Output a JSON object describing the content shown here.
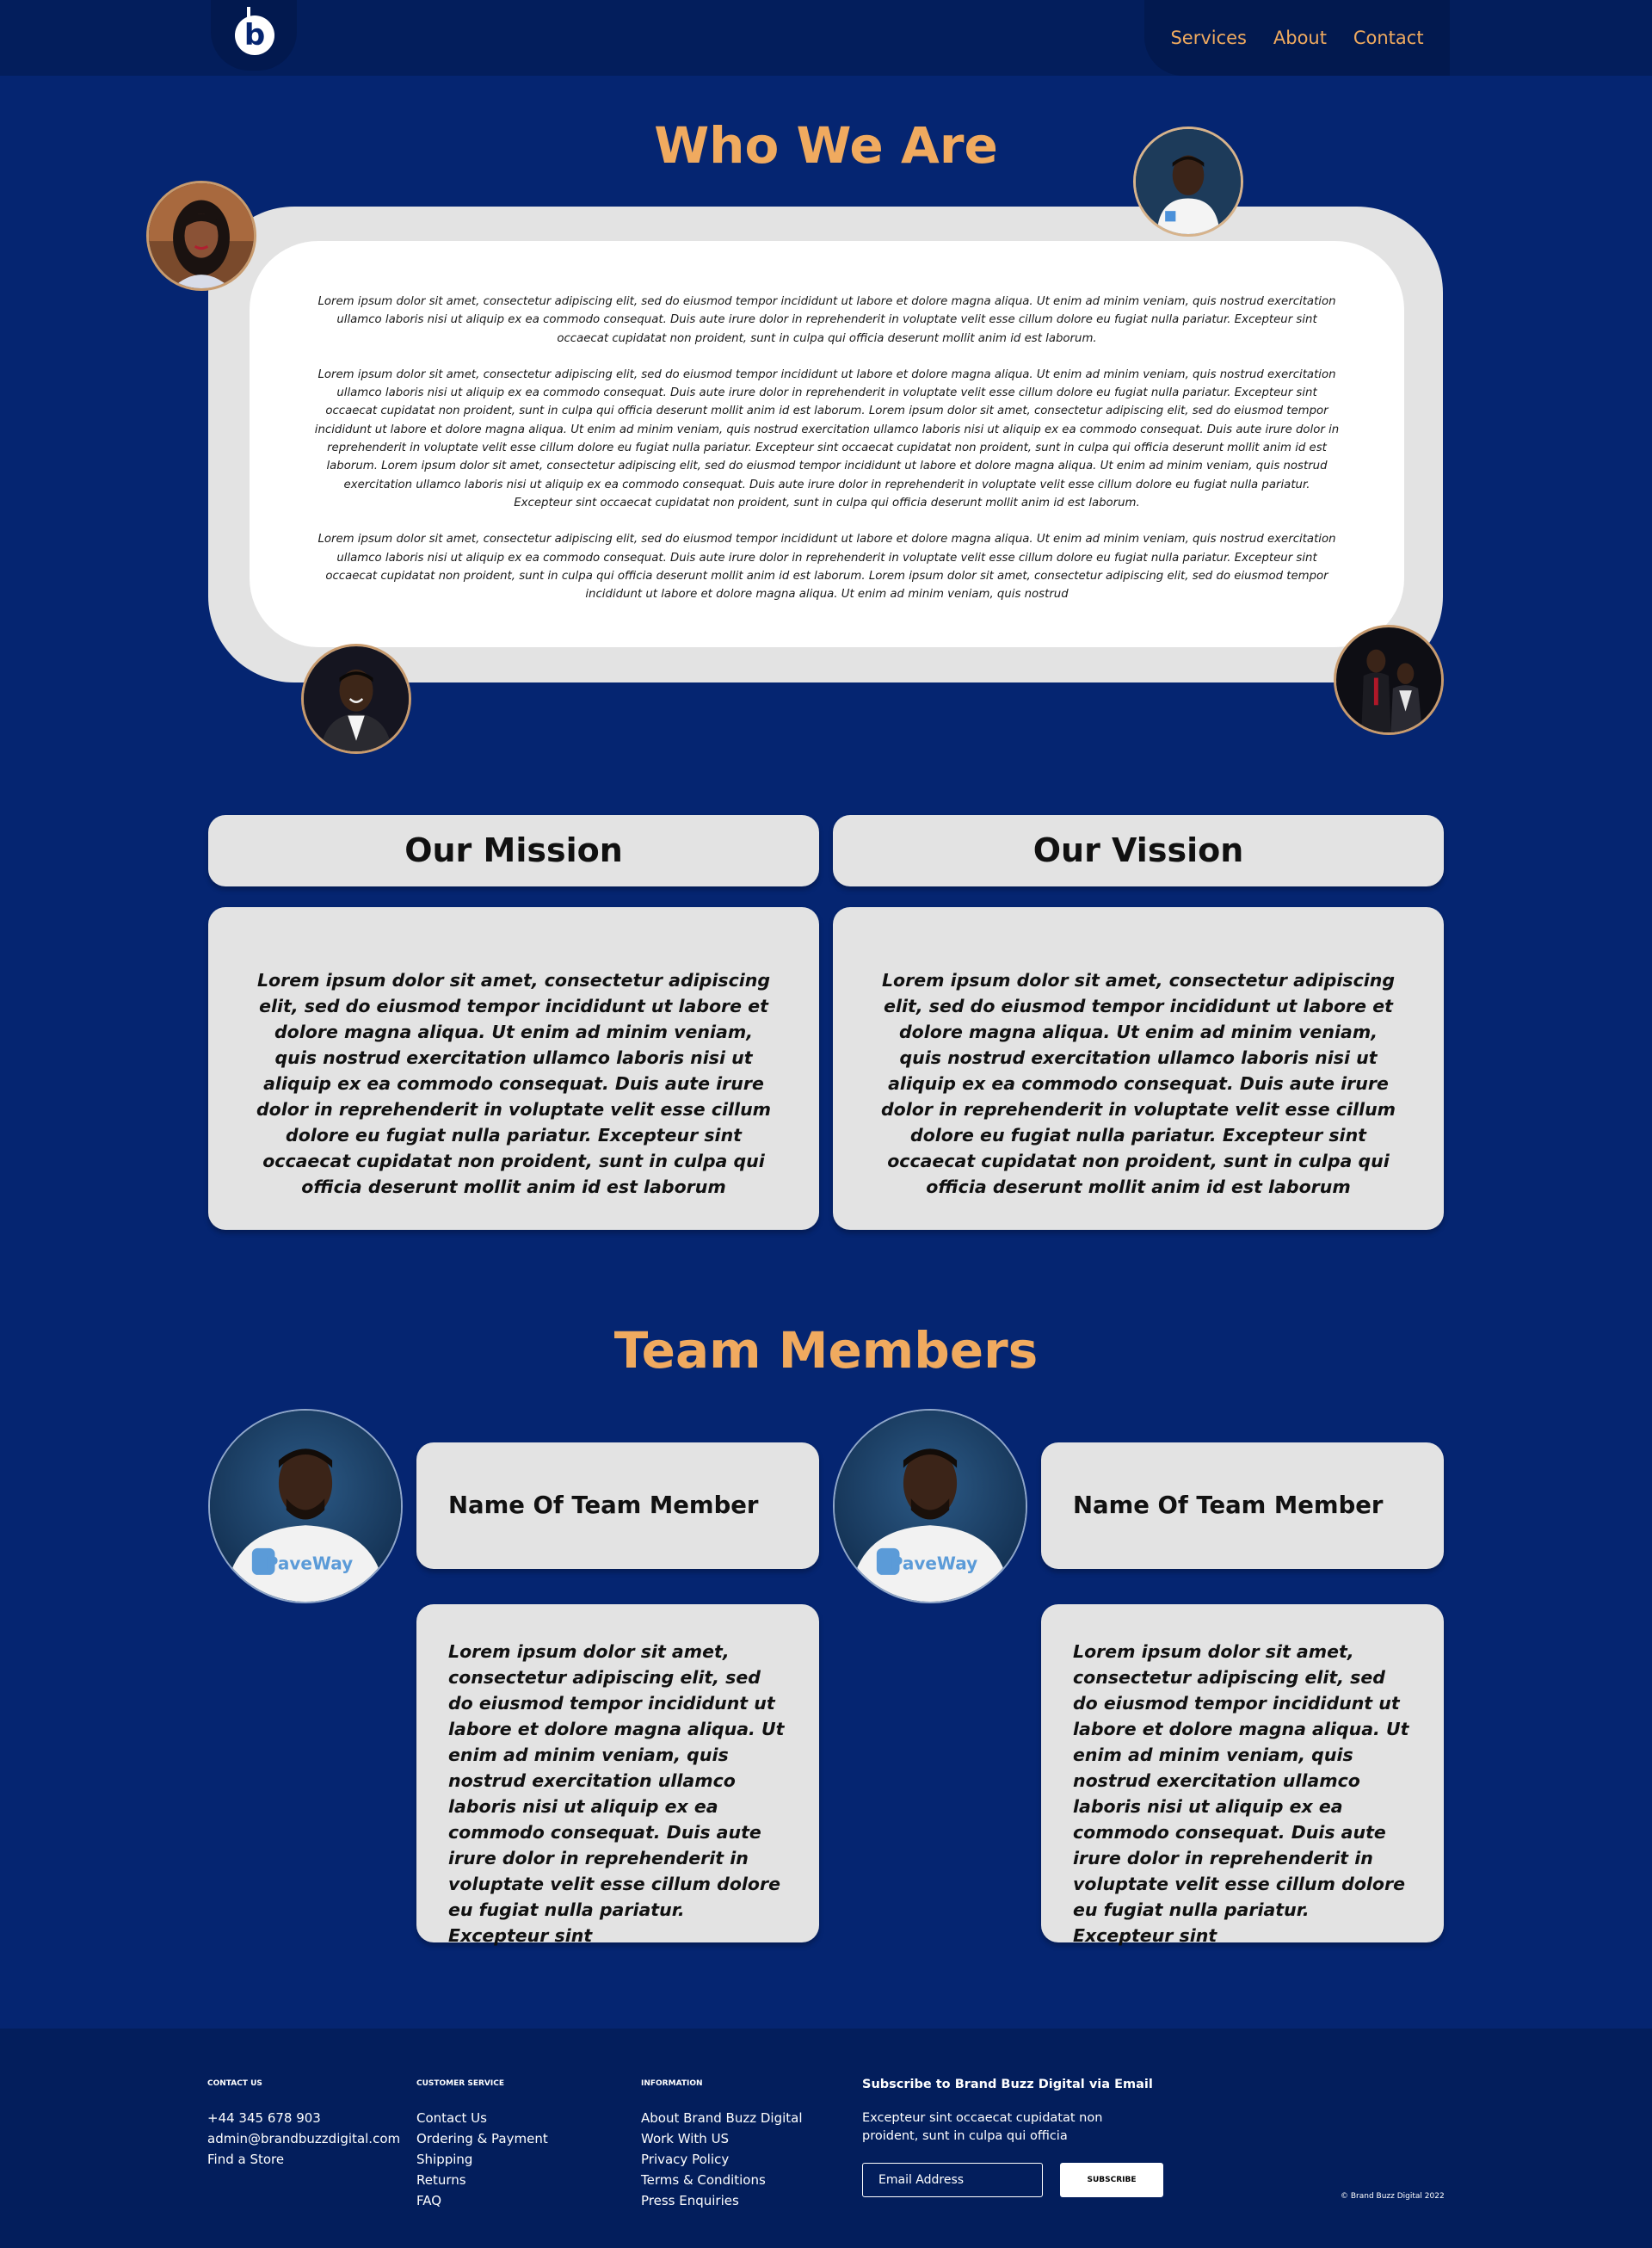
{
  "nav": {
    "logo_letter": "b",
    "links": [
      "Services",
      "About",
      "Contact"
    ]
  },
  "who": {
    "title": "Who We Are",
    "paragraphs": [
      "Lorem ipsum dolor sit amet, consectetur adipiscing elit, sed do eiusmod tempor incididunt ut labore et dolore magna aliqua. Ut enim ad minim veniam, quis nostrud exercitation ullamco laboris nisi ut aliquip ex ea commodo consequat. Duis aute irure dolor in reprehenderit in voluptate velit esse cillum dolore eu fugiat nulla pariatur. Excepteur sint occaecat cupidatat non proident, sunt in culpa qui officia deserunt mollit anim id est laborum.",
      "Lorem ipsum dolor sit amet, consectetur adipiscing elit, sed do eiusmod tempor incididunt ut labore et dolore magna aliqua. Ut enim ad minim veniam, quis nostrud exercitation ullamco laboris nisi ut aliquip ex ea commodo consequat. Duis aute irure dolor in reprehenderit in voluptate velit esse cillum dolore eu fugiat nulla pariatur. Excepteur sint occaecat cupidatat non proident, sunt in culpa qui officia deserunt mollit anim id est laborum. Lorem ipsum dolor sit amet, consectetur adipiscing elit, sed do eiusmod tempor incididunt ut labore et dolore magna aliqua. Ut enim ad minim veniam, quis nostrud exercitation ullamco laboris nisi ut aliquip ex ea commodo consequat. Duis aute irure dolor in reprehenderit in voluptate velit esse cillum dolore eu fugiat nulla pariatur. Excepteur sint occaecat cupidatat non proident, sunt in culpa qui officia deserunt mollit anim id est laborum. Lorem ipsum dolor sit amet, consectetur adipiscing elit, sed do eiusmod tempor incididunt ut labore et dolore magna aliqua. Ut enim ad minim veniam, quis nostrud exercitation ullamco laboris nisi ut aliquip ex ea commodo consequat. Duis aute irure dolor in reprehenderit in voluptate velit esse cillum dolore eu fugiat nulla pariatur. Excepteur sint occaecat cupidatat non proident, sunt in culpa qui officia deserunt mollit anim id est laborum.",
      "Lorem ipsum dolor sit amet, consectetur adipiscing elit, sed do eiusmod tempor incididunt ut labore et dolore magna aliqua. Ut enim ad minim veniam, quis nostrud exercitation ullamco laboris nisi ut aliquip ex ea commodo consequat. Duis aute irure dolor in reprehenderit in voluptate velit esse cillum dolore eu fugiat nulla pariatur. Excepteur sint occaecat cupidatat non proident, sunt in culpa qui officia deserunt mollit anim id est laborum. Lorem ipsum dolor sit amet, consectetur adipiscing elit, sed do eiusmod tempor incididunt ut labore et dolore magna aliqua. Ut enim ad minim veniam, quis nostrud"
    ]
  },
  "mission": {
    "title": "Our Mission",
    "text": "Lorem ipsum dolor sit amet, consectetur adipiscing elit, sed do eiusmod tempor incididunt ut labore et dolore magna aliqua. Ut enim ad minim veniam, quis nostrud exercitation ullamco laboris nisi ut aliquip ex ea commodo consequat. Duis aute irure dolor in reprehenderit in voluptate velit esse cillum dolore eu fugiat nulla pariatur. Excepteur sint occaecat cupidatat non proident, sunt in culpa qui officia deserunt mollit anim id est laborum"
  },
  "vision": {
    "title": "Our Vission",
    "text": "Lorem ipsum dolor sit amet, consectetur adipiscing elit, sed do eiusmod tempor incididunt ut labore et dolore magna aliqua. Ut enim ad minim veniam, quis nostrud exercitation ullamco laboris nisi ut aliquip ex ea commodo consequat. Duis aute irure dolor in reprehenderit in voluptate velit esse cillum dolore eu fugiat nulla pariatur. Excepteur sint occaecat cupidatat non proident, sunt in culpa qui officia deserunt mollit anim id est laborum"
  },
  "team": {
    "title": "Team Members",
    "shirt_text": "PaveWay",
    "members": [
      {
        "name": "Name Of Team Member",
        "bio": "Lorem ipsum dolor sit amet, consectetur adipiscing elit, sed do eiusmod tempor incididunt ut labore et dolore magna aliqua. Ut enim ad minim veniam, quis nostrud exercitation ullamco laboris nisi ut aliquip ex ea commodo consequat. Duis aute irure dolor in reprehenderit in voluptate velit esse cillum dolore eu fugiat nulla pariatur. Excepteur sint"
      },
      {
        "name": "Name Of Team Member",
        "bio": "Lorem ipsum dolor sit amet, consectetur adipiscing elit, sed do eiusmod tempor incididunt ut labore et dolore magna aliqua. Ut enim ad minim veniam, quis nostrud exercitation ullamco laboris nisi ut aliquip ex ea commodo consequat. Duis aute irure dolor in reprehenderit in voluptate velit esse cillum dolore eu fugiat nulla pariatur. Excepteur sint"
      }
    ]
  },
  "footer": {
    "contact": {
      "heading": "CONTACT US",
      "items": [
        "+44 345 678 903",
        "admin@brandbuzzdigital.com",
        "Find a Store"
      ]
    },
    "service": {
      "heading": "CUSTOMER SERVICE",
      "items": [
        "Contact Us",
        "Ordering & Payment",
        "Shipping",
        "Returns",
        "FAQ"
      ]
    },
    "info": {
      "heading": "INFORMATION",
      "items": [
        "About Brand Buzz Digital",
        "Work With US",
        "Privacy Policy",
        "Terms & Conditions",
        "Press Enquiries"
      ]
    },
    "subscribe": {
      "title": "Subscribe to Brand Buzz Digital via Email",
      "text": "Excepteur sint occaecat cupidatat non proident, sunt in culpa qui officia",
      "placeholder": "Email Address",
      "button": "SUBSCRIBE"
    },
    "copyright": "© Brand Buzz Digital 2022"
  },
  "colors": {
    "background": "#052571",
    "nav": "#031e5c",
    "accent": "#f0aa5f",
    "card": "#e3e3e3"
  }
}
